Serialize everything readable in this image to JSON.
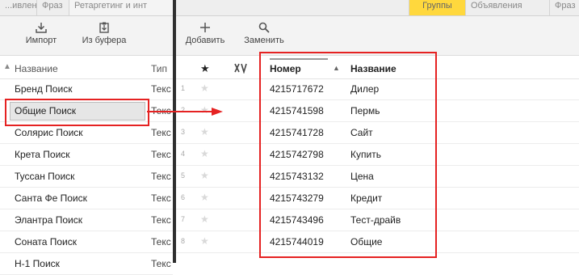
{
  "left_pane": {
    "tabs": [
      "...ивлен",
      "Фраз",
      "Ретаргетинг и инт"
    ],
    "toolbar": {
      "import_label": "Импорт",
      "clipboard_label": "Из буфера"
    },
    "columns": {
      "name": "Название",
      "type": "Тип"
    },
    "rows": [
      {
        "name": "Бренд Поиск",
        "type": "Текс"
      },
      {
        "name": "Общие Поиск",
        "type": "Текс"
      },
      {
        "name": "Солярис Поиск",
        "type": "Текс"
      },
      {
        "name": "Крета Поиск",
        "type": "Текс"
      },
      {
        "name": "Туссан Поиск",
        "type": "Текс"
      },
      {
        "name": "Санта Фе Поиск",
        "type": "Текс"
      },
      {
        "name": "Элантра Поиск",
        "type": "Текс"
      },
      {
        "name": "Соната Поиск",
        "type": "Текс"
      },
      {
        "name": "Н-1 Поиск",
        "type": "Текс"
      }
    ],
    "selected_index": 1
  },
  "right_pane": {
    "tabs": [
      "",
      "Группы",
      "Объявления",
      "Фраз"
    ],
    "active_tab": "Группы",
    "toolbar": {
      "add_label": "Добавить",
      "replace_label": "Заменить"
    },
    "columns": {
      "star": "★",
      "number": "Номер",
      "name": "Название"
    },
    "rows": [
      {
        "index": "1",
        "number": "4215717672",
        "name": "Дилер"
      },
      {
        "index": "2",
        "number": "4215741598",
        "name": "Пермь"
      },
      {
        "index": "3",
        "number": "4215741728",
        "name": "Сайт"
      },
      {
        "index": "4",
        "number": "4215742798",
        "name": "Купить"
      },
      {
        "index": "5",
        "number": "4215743132",
        "name": "Цена"
      },
      {
        "index": "6",
        "number": "4215743279",
        "name": "Кредит"
      },
      {
        "index": "7",
        "number": "4215743496",
        "name": "Тест-драйв"
      },
      {
        "index": "8",
        "number": "4215744019",
        "name": "Общие"
      }
    ]
  },
  "annotation_color": "#e52222",
  "active_tab_color": "#ffd83d"
}
